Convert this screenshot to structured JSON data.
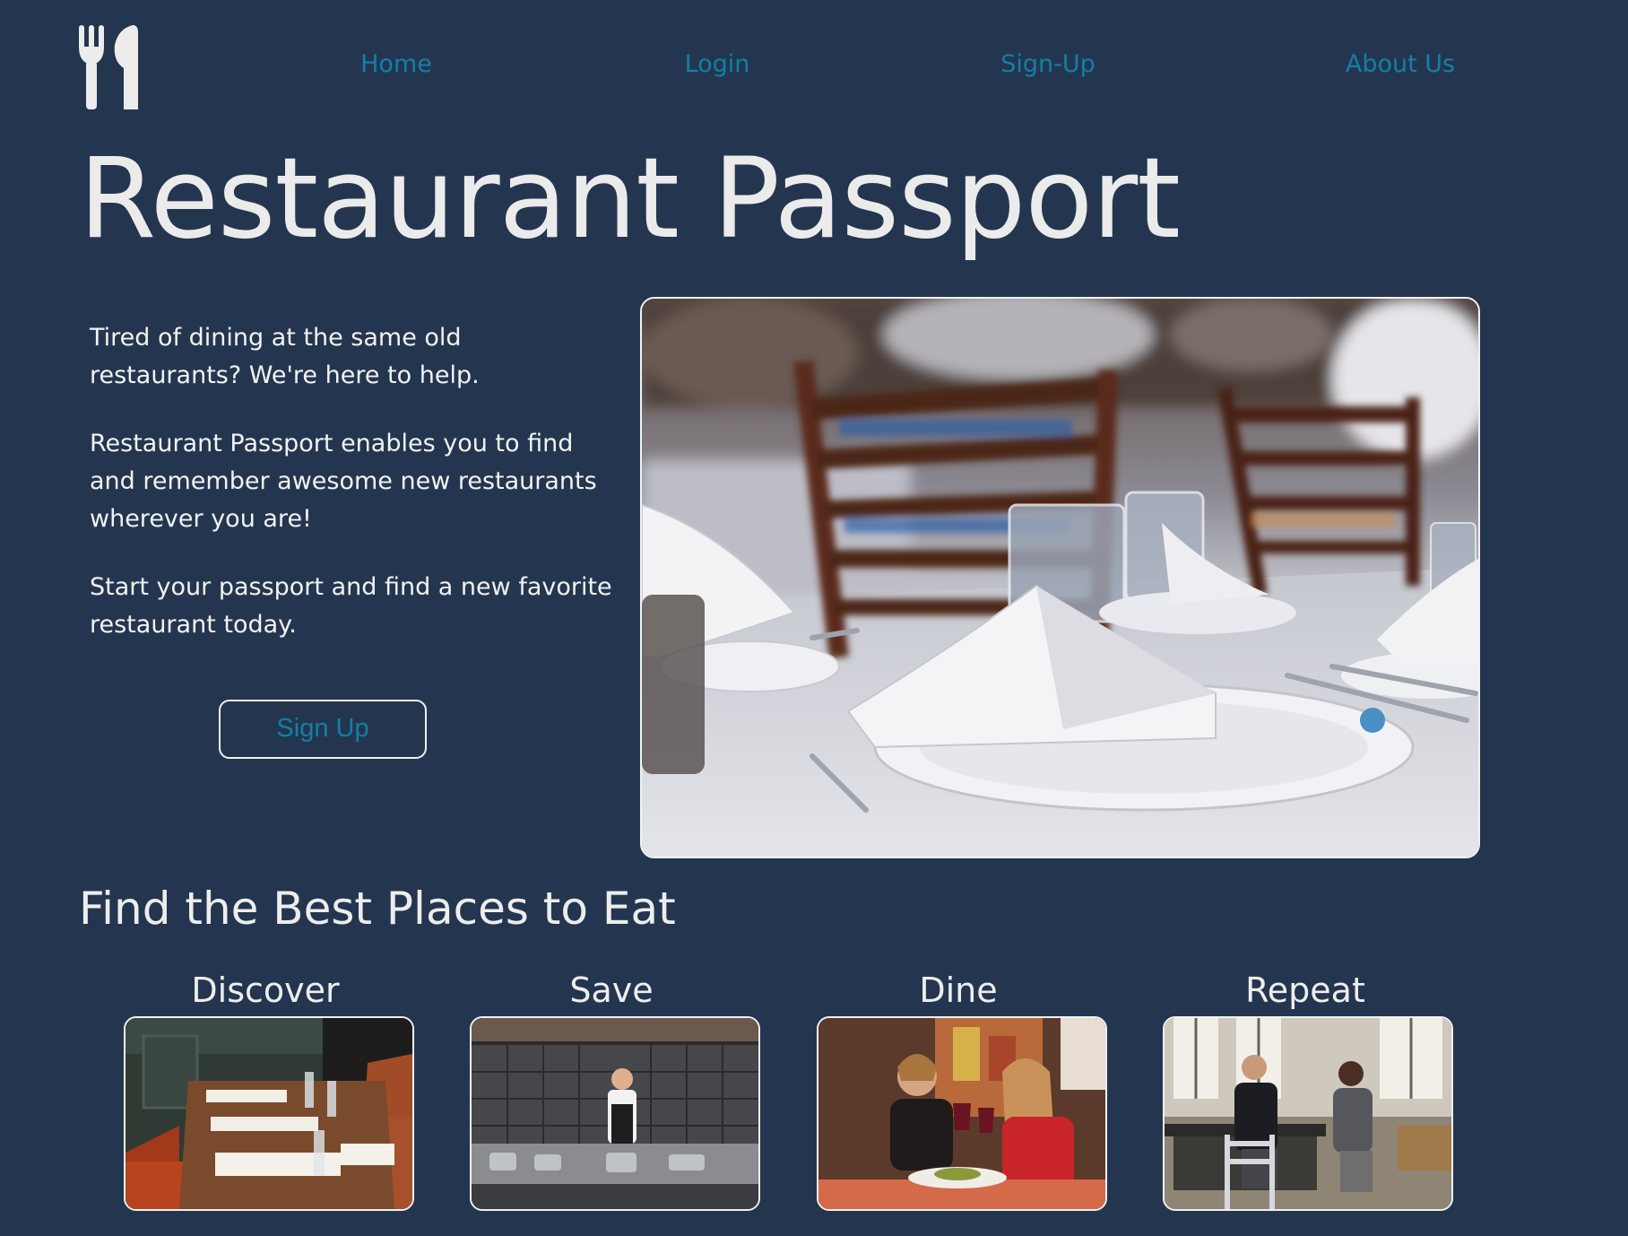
{
  "brand": {
    "logo_icon": "fork-knife-icon"
  },
  "nav": {
    "items": [
      {
        "label": "Home"
      },
      {
        "label": "Login"
      },
      {
        "label": "Sign-Up"
      },
      {
        "label": "About Us"
      }
    ],
    "link_color": "#137fa8"
  },
  "hero": {
    "title": "Restaurant Passport",
    "paragraphs": [
      "Tired of dining at the same old restaurants? We're here to help.",
      "Restaurant Passport enables you to find and remember awesome new restaurants wherever you are!",
      "Start your passport and find a new favorite restaurant today."
    ],
    "signup_label": "Sign Up"
  },
  "features": {
    "heading": "Find the Best Places to Eat",
    "cards": [
      {
        "label": "Discover"
      },
      {
        "label": "Save"
      },
      {
        "label": "Dine"
      },
      {
        "label": "Repeat"
      }
    ]
  },
  "colors": {
    "background": "#24364f",
    "text": "#eeeeee",
    "accent": "#137fa8"
  }
}
